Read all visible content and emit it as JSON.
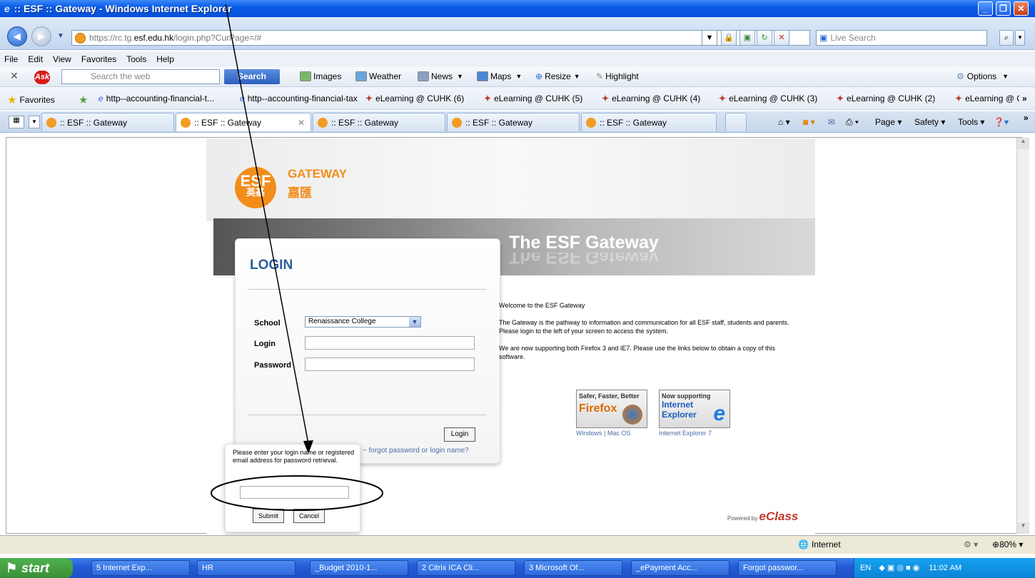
{
  "window": {
    "title": ":: ESF :: Gateway - Windows Internet Explorer"
  },
  "address": {
    "scheme": "https://rc.tg.",
    "host": "esf.edu.hk",
    "path": "/login.php?CurPage=/#",
    "live_search_placeholder": "Live Search"
  },
  "menu": [
    "File",
    "Edit",
    "View",
    "Favorites",
    "Tools",
    "Help"
  ],
  "ask_toolbar": {
    "search_placeholder": "Search the web",
    "search_button": "Search",
    "items": [
      "Images",
      "Weather",
      "News",
      "Maps",
      "Resize",
      "Highlight"
    ],
    "options": "Options"
  },
  "favorites": {
    "label": "Favorites",
    "items": [
      "http--accounting-financial-t...",
      "http--accounting-financial-tax",
      "eLearning @ CUHK (6)",
      "eLearning @ CUHK (5)",
      "eLearning @ CUHK (4)",
      "eLearning @ CUHK (3)",
      "eLearning @ CUHK (2)",
      "eLearning @ CUHK"
    ]
  },
  "tabs": [
    ":: ESF :: Gateway",
    ":: ESF :: Gateway",
    ":: ESF :: Gateway",
    ":: ESF :: Gateway",
    ":: ESF :: Gateway"
  ],
  "command_bar": {
    "page": "Page",
    "safety": "Safety",
    "tools": "Tools"
  },
  "esf": {
    "logo_text": "ESF",
    "logo_cn": "英基",
    "gateway": "GATEWAY",
    "gateway_cn": "嘉匯",
    "banner_title": "The ESF Gateway",
    "login_title": "LOGIN",
    "school_label": "School",
    "school_value": "Renaissance College",
    "login_label": "Login",
    "password_label": "Password",
    "login_button": "Login",
    "forgot_link": "forgot password or login name?",
    "popup_text": "Please enter your login name or registered email address for password retrieval.",
    "submit_button": "Submit",
    "cancel_button": "Cancel",
    "welcome_heading": "Welcome to the ESF Gateway",
    "welcome_p1": "The Gateway is the pathway to information and communication for all ESF staff, students and parents. Please login to the left of your screen to access the system.",
    "welcome_p2": "We are now supporting both Firefox 3 and IE7. Please use the links below to obtain a copy of this software.",
    "ff_badge_top": "Safer, Faster, Better",
    "ff_badge_name": "Firefox",
    "ie_badge_top": "Now supporting",
    "ie_badge_l1": "Internet",
    "ie_badge_l2": "Explorer",
    "ff_links": "Windows | Mac OS",
    "ie_link": "Internet Explorer 7",
    "powered_by": "Powered by",
    "eclass": "eClass"
  },
  "status": {
    "zone": "Internet",
    "zoom": "80%"
  },
  "taskbar": {
    "start": "start",
    "items": [
      "5 Internet Exp...",
      "HR",
      "_Budget 2010-1...",
      "2 Citrix ICA Cli...",
      "3 Microsoft Of...",
      "_ePayment Acc...",
      "Forgot passwor..."
    ],
    "lang": "EN",
    "clock": "11:02 AM"
  }
}
